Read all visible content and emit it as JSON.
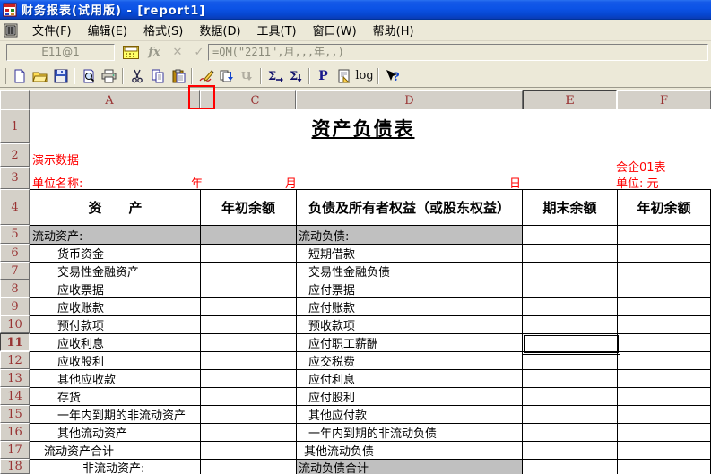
{
  "window": {
    "title": "财务报表(试用版) - [report1]"
  },
  "menu": {
    "items": [
      "文件(F)",
      "编辑(E)",
      "格式(S)",
      "数据(D)",
      "工具(T)",
      "窗口(W)",
      "帮助(H)"
    ]
  },
  "formula_bar": {
    "cell_ref": "E11@1",
    "fx_label": "fx",
    "cancel_glyph": "✕",
    "confirm_glyph": "✓",
    "formula": "=QM(\"2211\",月,,,年,,)"
  },
  "toolbar": {
    "icons": [
      "new",
      "open",
      "save",
      "print-preview",
      "print",
      "cut",
      "copy",
      "paste",
      "audit-pen",
      "collate-down",
      "undo-down",
      "sum-row",
      "sum-column",
      "precision",
      "page-flip",
      "log",
      "help"
    ],
    "glyphs": {
      "sigma": "Σ",
      "p": "P",
      "log": "log",
      "u": "U",
      "help_arrow": "➤",
      "help_q": "?"
    }
  },
  "columns": {
    "a": "A",
    "c": "C",
    "d": "D",
    "e": "E",
    "f": "F"
  },
  "sheet": {
    "title": "资产负债表",
    "demo_note": "演示数据",
    "form_code": "会企01表",
    "unit_name_label": "单位名称:",
    "year_label": "年",
    "month_label": "月",
    "day_label": "日",
    "unit_label": "单位: 元",
    "row_numbers": [
      "1",
      "2",
      "3",
      "4",
      "5",
      "6",
      "7",
      "8",
      "9",
      "10",
      "11",
      "12",
      "13",
      "14",
      "15",
      "16",
      "17",
      "18"
    ],
    "header": {
      "assets": "资　　产",
      "begin_balance": "年初余额",
      "liabilities": "负债及所有者权益（或股东权益）",
      "end_balance": "期末余额",
      "begin_balance2": "年初余额"
    },
    "rows": [
      {
        "n": 5,
        "left": "流动资产:",
        "right": "流动负债:",
        "left_type": "section",
        "right_type": "section"
      },
      {
        "n": 6,
        "left": "货币资金",
        "right": "短期借款",
        "left_type": "item",
        "right_type": "item2"
      },
      {
        "n": 7,
        "left": "交易性金融资产",
        "right": "交易性金融负债",
        "left_type": "item",
        "right_type": "item2"
      },
      {
        "n": 8,
        "left": "应收票据",
        "right": "应付票据",
        "left_type": "item",
        "right_type": "item2"
      },
      {
        "n": 9,
        "left": "应收账款",
        "right": "应付账款",
        "left_type": "item",
        "right_type": "item2"
      },
      {
        "n": 10,
        "left": "预付款项",
        "right": "预收款项",
        "left_type": "item",
        "right_type": "item2"
      },
      {
        "n": 11,
        "left": "应收利息",
        "right": "应付职工薪酬",
        "left_type": "item",
        "right_type": "item2",
        "active": true
      },
      {
        "n": 12,
        "left": "应收股利",
        "right": "应交税费",
        "left_type": "item",
        "right_type": "item2"
      },
      {
        "n": 13,
        "left": "其他应收款",
        "right": "应付利息",
        "left_type": "item",
        "right_type": "item2"
      },
      {
        "n": 14,
        "left": "存货",
        "right": "应付股利",
        "left_type": "item",
        "right_type": "item2"
      },
      {
        "n": 15,
        "left": "一年内到期的非流动资产",
        "right": "其他应付款",
        "left_type": "item",
        "right_type": "item2"
      },
      {
        "n": 16,
        "left": "其他流动资产",
        "right": "一年内到期的非流动负债",
        "left_type": "item",
        "right_type": "item2"
      },
      {
        "n": 17,
        "left": "流动资产合计",
        "right": "其他流动负债",
        "left_type": "total",
        "right_type": "small"
      },
      {
        "n": 18,
        "left": "非流动资产:",
        "right": "流动负债合计",
        "left_type": "sub",
        "right_type": "section-gray"
      }
    ]
  }
}
